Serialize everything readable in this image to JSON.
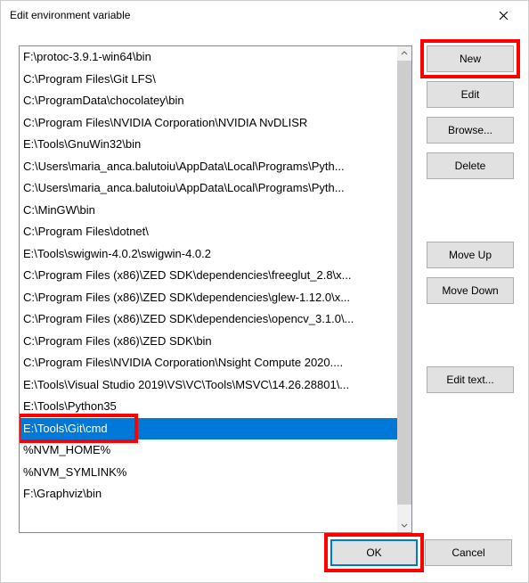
{
  "titlebar": {
    "title": "Edit environment variable"
  },
  "list": {
    "items": [
      "F:\\protoc-3.9.1-win64\\bin",
      "C:\\Program Files\\Git LFS\\",
      "C:\\ProgramData\\chocolatey\\bin",
      "C:\\Program Files\\NVIDIA Corporation\\NVIDIA NvDLISR",
      "E:\\Tools\\GnuWin32\\bin",
      "C:\\Users\\maria_anca.balutoiu\\AppData\\Local\\Programs\\Pyth...",
      "C:\\Users\\maria_anca.balutoiu\\AppData\\Local\\Programs\\Pyth...",
      "C:\\MinGW\\bin",
      "C:\\Program Files\\dotnet\\",
      "E:\\Tools\\swigwin-4.0.2\\swigwin-4.0.2",
      "C:\\Program Files (x86)\\ZED SDK\\dependencies\\freeglut_2.8\\x...",
      "C:\\Program Files (x86)\\ZED SDK\\dependencies\\glew-1.12.0\\x...",
      "C:\\Program Files (x86)\\ZED SDK\\dependencies\\opencv_3.1.0\\...",
      "C:\\Program Files (x86)\\ZED SDK\\bin",
      "C:\\Program Files\\NVIDIA Corporation\\Nsight Compute 2020....",
      "E:\\Tools\\Visual Studio 2019\\VS\\VC\\Tools\\MSVC\\14.26.28801\\...",
      "E:\\Tools\\Python35",
      "E:\\Tools\\Git\\cmd",
      "%NVM_HOME%",
      "%NVM_SYMLINK%",
      "F:\\Graphviz\\bin"
    ],
    "selectedIndex": 17
  },
  "buttons": {
    "new": "New",
    "edit": "Edit",
    "browse": "Browse...",
    "delete": "Delete",
    "moveUp": "Move Up",
    "moveDown": "Move Down",
    "editText": "Edit text...",
    "ok": "OK",
    "cancel": "Cancel"
  }
}
